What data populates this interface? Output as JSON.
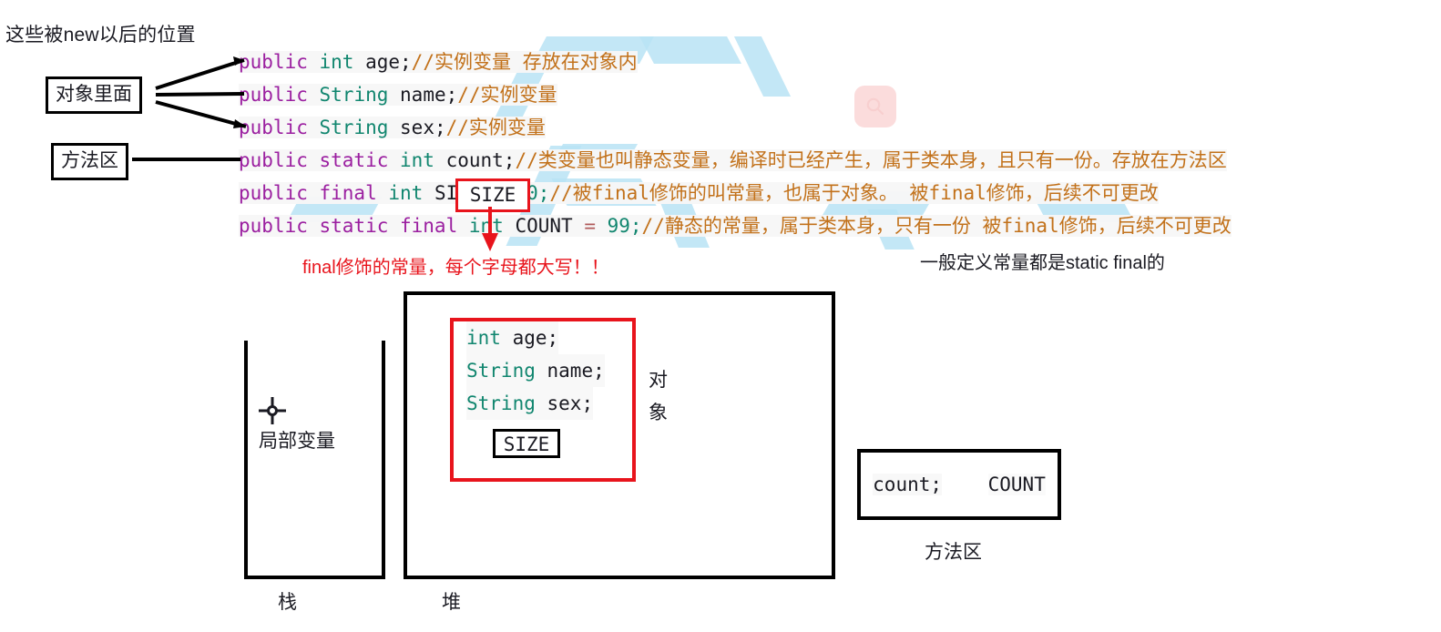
{
  "top_note": "这些被new以后的位置",
  "labels": {
    "object_inside": "对象里面",
    "method_area": "方法区"
  },
  "code": {
    "lines": [
      {
        "tokens": [
          {
            "t": "public ",
            "c": "kw"
          },
          {
            "t": "int ",
            "c": "type"
          },
          {
            "t": "age;",
            "c": "ident"
          },
          {
            "t": "//实例变量    存放在对象内",
            "c": "cmt"
          }
        ]
      },
      {
        "tokens": [
          {
            "t": "public ",
            "c": "kw"
          },
          {
            "t": "String ",
            "c": "type"
          },
          {
            "t": "name;",
            "c": "ident"
          },
          {
            "t": "//实例变量",
            "c": "cmt"
          }
        ]
      },
      {
        "tokens": [
          {
            "t": "public ",
            "c": "kw"
          },
          {
            "t": "String ",
            "c": "type"
          },
          {
            "t": "sex;",
            "c": "ident"
          },
          {
            "t": "//实例变量",
            "c": "cmt"
          }
        ]
      },
      {
        "tokens": [
          {
            "t": "public static ",
            "c": "kw"
          },
          {
            "t": "int ",
            "c": "type"
          },
          {
            "t": "count;",
            "c": "ident"
          },
          {
            "t": "//类变量也叫静态变量，编译时已经产生，属于类本身，且只有一份。存放在方法区",
            "c": "cmt"
          }
        ]
      },
      {
        "tokens": [
          {
            "t": "public final ",
            "c": "kw"
          },
          {
            "t": "int ",
            "c": "type"
          },
          {
            "t": "SIZE ",
            "c": "ident"
          },
          {
            "t": "= ",
            "c": "op"
          },
          {
            "t": "10;",
            "c": "num"
          },
          {
            "t": "//被final修饰的叫常量，也属于对象。 被final修饰，后续不可更改",
            "c": "cmt"
          }
        ]
      },
      {
        "tokens": [
          {
            "t": "public static final ",
            "c": "kw"
          },
          {
            "t": "int ",
            "c": "type"
          },
          {
            "t": " COUNT ",
            "c": "ident"
          },
          {
            "t": "= ",
            "c": "op"
          },
          {
            "t": "99;",
            "c": "num"
          },
          {
            "t": "//静态的常量，属于类本身，只有一份  被final修饰，后续不可更改",
            "c": "cmt"
          }
        ]
      }
    ],
    "size_highlight": "SIZE"
  },
  "annotations": {
    "red_note": "final修饰的常量，每个字母都大写！！",
    "static_final_note": "一般定义常量都是static final的"
  },
  "stack": {
    "local_variable": "局部变量",
    "label": "栈"
  },
  "heap": {
    "label": "堆",
    "object_label": "对\n象",
    "object_label_char1": "对",
    "object_label_char2": "象",
    "object_fields": [
      "int age;",
      "String name;",
      "String sex;"
    ],
    "object_field_tokens": [
      [
        {
          "t": "int ",
          "c": "type"
        },
        {
          "t": "age;",
          "c": "ident"
        }
      ],
      [
        {
          "t": "String ",
          "c": "type"
        },
        {
          "t": "name;",
          "c": "ident"
        }
      ],
      [
        {
          "t": "String ",
          "c": "type"
        },
        {
          "t": "sex;",
          "c": "ident"
        }
      ]
    ],
    "object_constant": "SIZE"
  },
  "method_area": {
    "entry_instance": "count;",
    "entry_static": "COUNT",
    "label": "方法区"
  },
  "colors": {
    "keyword": "#9b1fa0",
    "type": "#11866f",
    "comment": "#c2711a",
    "number": "#11866f",
    "red_accent": "#e8141c",
    "watermark_blue": "#b9e3f4",
    "watermark_pink": "#fbdcdc",
    "code_bg": "#f7f7f7",
    "line": "#000000"
  },
  "icons": {
    "crosshair": "crosshair-icon",
    "search_watermark": "search-icon"
  }
}
